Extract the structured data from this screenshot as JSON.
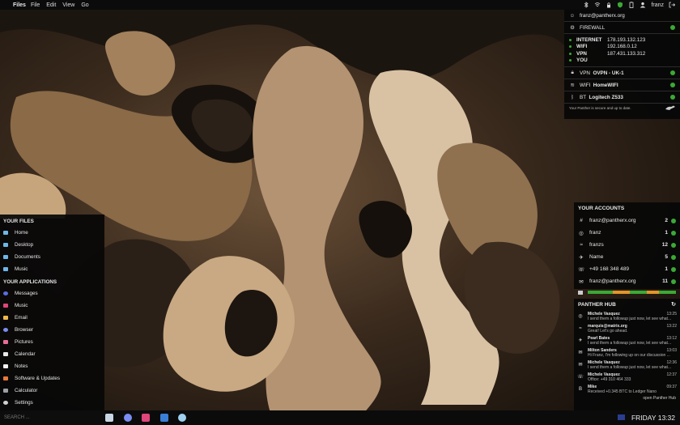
{
  "topbar": {
    "app": "Files",
    "menus": [
      "File",
      "Edit",
      "View",
      "Go"
    ],
    "user": "franz"
  },
  "firewall": {
    "account": "franz@pantherx.org",
    "firewall_label": "FIREWALL",
    "connections": [
      {
        "key": "INTERNET",
        "value": "178.193.132.123"
      },
      {
        "key": "WIFI",
        "value": "192.168.0.12"
      },
      {
        "key": "VPN",
        "value": "187.431.133.312"
      },
      {
        "key": "YOU",
        "value": ""
      }
    ],
    "vpn": {
      "label": "VPN",
      "value": "OVPN - UK-1"
    },
    "wifi": {
      "label": "WIFI",
      "value": "HomeWIFI"
    },
    "bt": {
      "label": "BT",
      "value": "Logitech Z533"
    },
    "status": "Your Panther is secure and up to date."
  },
  "files": {
    "header": "YOUR FILES",
    "items": [
      "Home",
      "Desktop",
      "Documents",
      "Music"
    ]
  },
  "apps": {
    "header": "YOUR APPLICATIONS",
    "items": [
      "Messages",
      "Music",
      "Email",
      "Browser",
      "Pictures",
      "Calendar",
      "Notes",
      "Software & Updates",
      "Calculator",
      "Settings"
    ]
  },
  "search": {
    "placeholder": "SEARCH ..."
  },
  "accounts": {
    "header": "YOUR ACCOUNTS",
    "items": [
      {
        "icon": "#",
        "name": "franz@pantherx.org",
        "count": "2"
      },
      {
        "icon": "◎",
        "name": "franz",
        "count": "1"
      },
      {
        "icon": "≈",
        "name": "franzs",
        "count": "12"
      },
      {
        "icon": "✈",
        "name": "Name",
        "count": "5"
      },
      {
        "icon": "☏",
        "name": "+49 168 348 489",
        "count": "1"
      },
      {
        "icon": "✉",
        "name": "franz@pantherx.org",
        "count": "11"
      }
    ]
  },
  "hub": {
    "header": "PANTHER HUB",
    "messages": [
      {
        "icon": "◎",
        "from": "Michele Vasquez",
        "time": "13:25",
        "text": "I send them a followup just now, let see what..."
      },
      {
        "icon": "≈",
        "from": "marquis@matrix.org",
        "time": "13:22",
        "text": "Great! Let's go ahead."
      },
      {
        "icon": "✈",
        "from": "Pearl Bates",
        "time": "13:12",
        "text": "I send them a followup just now, let see what..."
      },
      {
        "icon": "✉",
        "from": "Milton Sanders",
        "time": "13:03",
        "text": "Hi Franz, I'm following up on our discussion ..."
      },
      {
        "icon": "✉",
        "from": "Michele Vasquez",
        "time": "12:36",
        "text": "I send them a followup just now, let see what..."
      },
      {
        "icon": "☏",
        "from": "Michele Vasquez",
        "time": "12:37",
        "text": "Office: +49 310 464 333"
      },
      {
        "icon": "B",
        "from": "Mike",
        "time": "09:37",
        "text": "Received +0.345 BTC to Ledger Nano"
      }
    ],
    "open": "open Panther Hub"
  },
  "clock": "FRIDAY 13:32"
}
